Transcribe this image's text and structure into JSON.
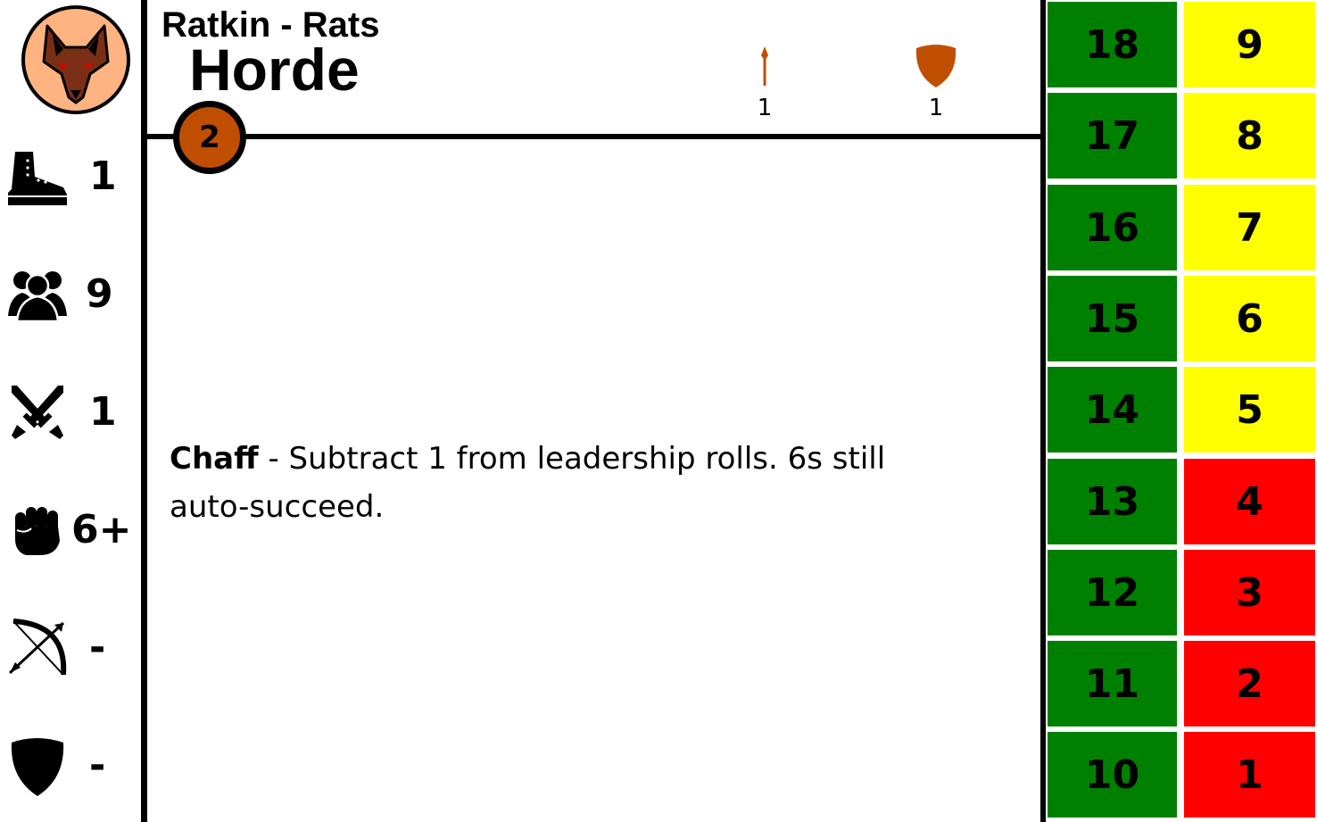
{
  "faction_icon": "rat-head-icon",
  "header": {
    "faction_title": "Ratkin - Rats",
    "unit_type": "Horde",
    "tier": "2"
  },
  "weapons": [
    {
      "icon": "spear-icon",
      "count": "1"
    },
    {
      "icon": "shield-icon",
      "count": "1"
    }
  ],
  "stats": [
    {
      "icon": "boot-icon",
      "value": "1"
    },
    {
      "icon": "group-icon",
      "value": "9"
    },
    {
      "icon": "crossed-swords-icon",
      "value": "1"
    },
    {
      "icon": "fist-icon",
      "value": "6+"
    },
    {
      "icon": "bow-icon",
      "value": "-"
    },
    {
      "icon": "shield-icon",
      "value": "-"
    }
  ],
  "ability": {
    "name": "Chaff",
    "text": " - Subtract 1 from leadership rolls. 6s still auto-succeed."
  },
  "health_track": {
    "left_column": [
      "18",
      "17",
      "16",
      "15",
      "14",
      "13",
      "12",
      "11",
      "10"
    ],
    "right_column": [
      "9",
      "8",
      "7",
      "6",
      "5",
      "4",
      "3",
      "2",
      "1"
    ],
    "colors": {
      "green": "#008000",
      "yellow": "#ffff00",
      "red": "#ff0000"
    },
    "right_column_colors": [
      "yellow",
      "yellow",
      "yellow",
      "yellow",
      "yellow",
      "red",
      "red",
      "red",
      "red"
    ]
  },
  "accent_color": "#c04e00",
  "badge_color": "#ffb380"
}
